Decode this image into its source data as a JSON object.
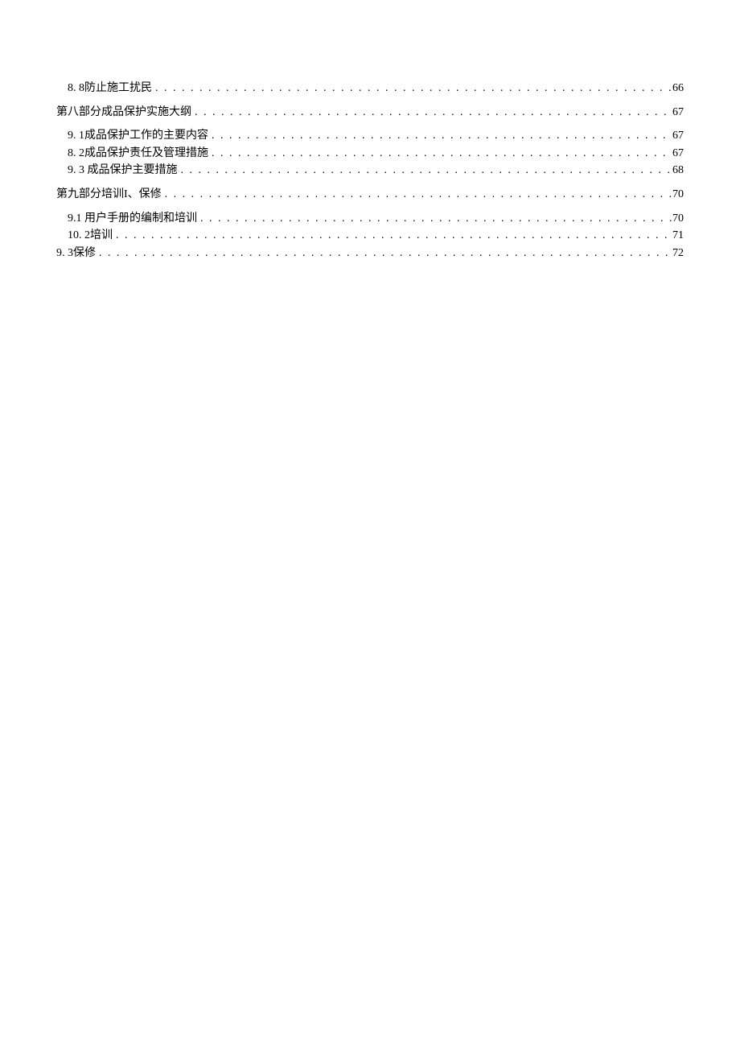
{
  "toc": {
    "entries": [
      {
        "level": "sub",
        "label": "8.  8防止施工扰民",
        "page": "66"
      },
      {
        "level": "section",
        "label": "第八部分成品保护实施大纲",
        "page": "67"
      },
      {
        "level": "sub",
        "label": "9.  1成品保护工作的主要内容",
        "page": "67"
      },
      {
        "level": "sub",
        "label": "8.  2成品保护责任及管理措施",
        "page": "67"
      },
      {
        "level": "sub",
        "label": "9.  3 成品保护主要措施",
        "page": "68"
      },
      {
        "level": "section",
        "label": "第九部分培训I、保修",
        "page": "70"
      },
      {
        "level": "sub",
        "label": "9.1    用户手册的编制和培训",
        "page": "70"
      },
      {
        "level": "sub",
        "label": "10.  2培训",
        "page": "71"
      },
      {
        "level": "sub-less",
        "label": "9. 3保修",
        "page": "72"
      }
    ]
  }
}
